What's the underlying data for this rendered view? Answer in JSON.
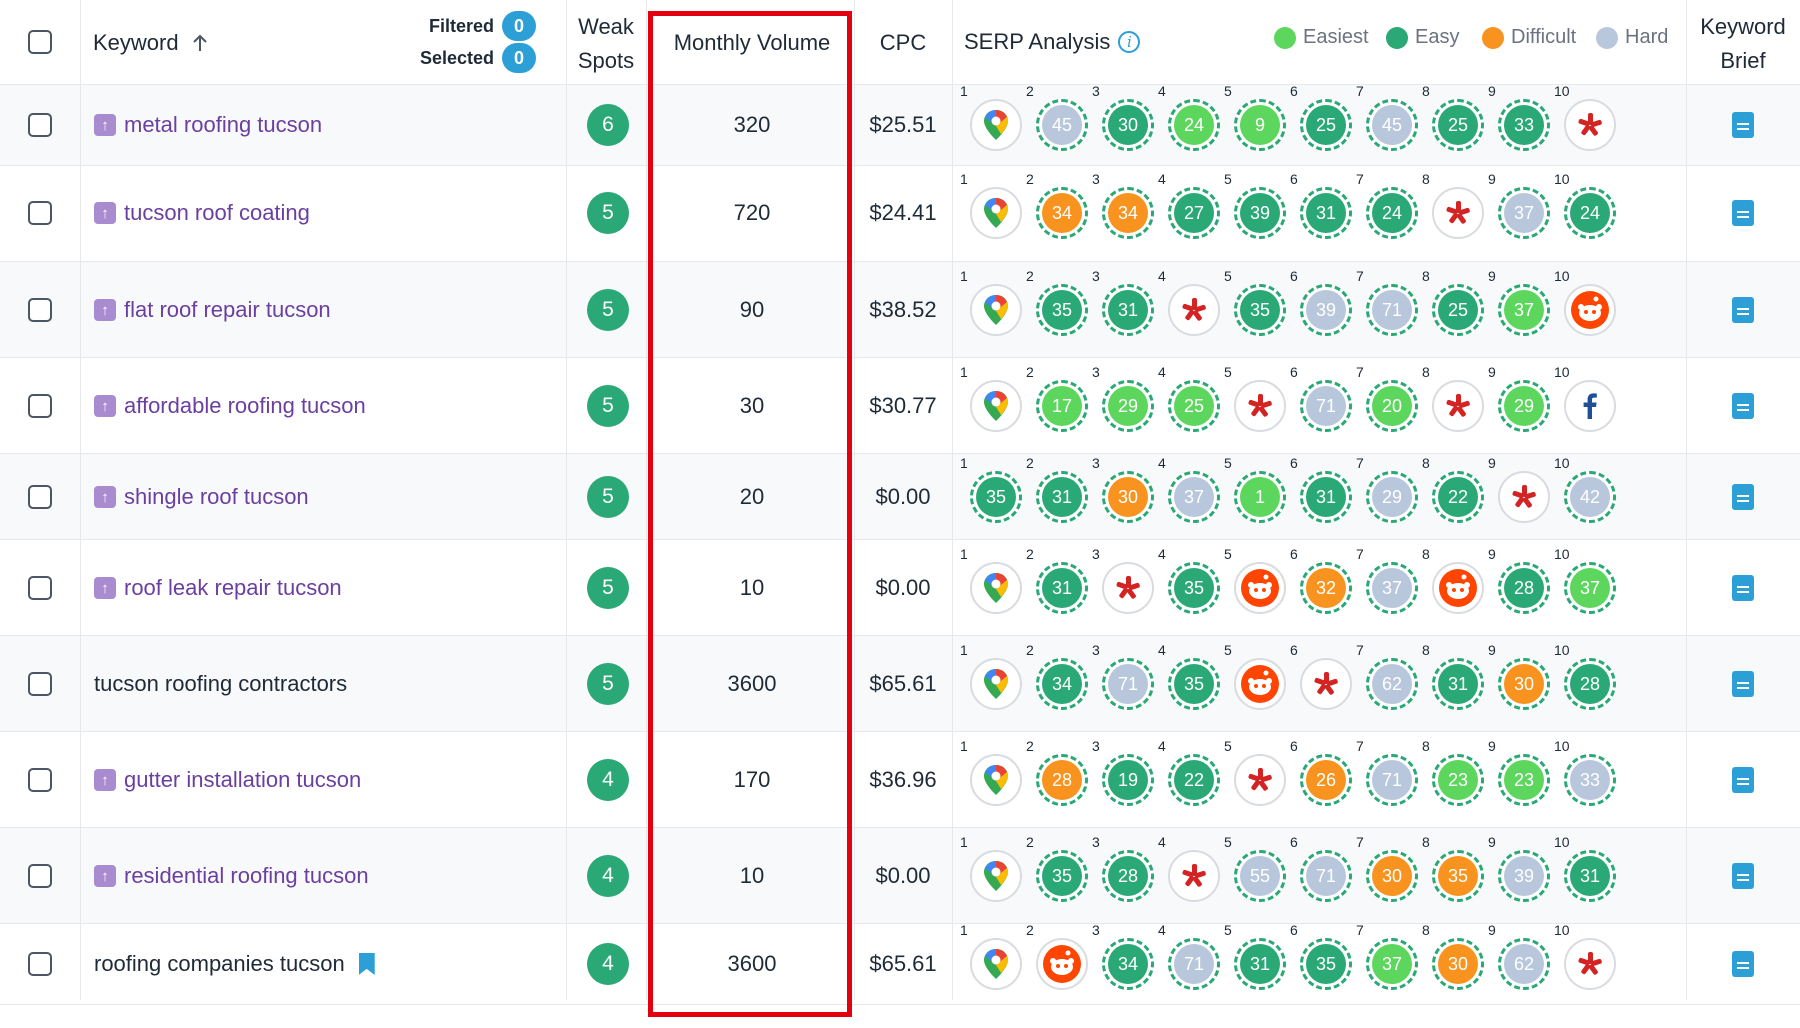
{
  "header": {
    "keyword_label": "Keyword",
    "sort_icon": "arrow-up-icon",
    "filtered_label": "Filtered",
    "filtered_count": "0",
    "selected_label": "Selected",
    "selected_count": "0",
    "weak_spots_line1": "Weak",
    "weak_spots_line2": "Spots",
    "monthly_volume": "Monthly Volume",
    "cpc": "CPC",
    "serp_analysis": "SERP Analysis",
    "keyword_brief_line1": "Keyword",
    "keyword_brief_line2": "Brief",
    "info_glyph": "i"
  },
  "legend": [
    {
      "label": "Easiest",
      "color": "#5cd65c"
    },
    {
      "label": "Easy",
      "color": "#2aa876"
    },
    {
      "label": "Difficult",
      "color": "#f7931e"
    },
    {
      "label": "Hard",
      "color": "#b8c7dc"
    }
  ],
  "colors": {
    "easiest": "#5cd65c",
    "easy": "#2aa876",
    "difficult": "#f7931e",
    "hard": "#b8c7dc",
    "highlight": "#e3000f",
    "keyword_link": "#6b3fa0"
  },
  "position_labels": [
    "1",
    "2",
    "3",
    "4",
    "5",
    "6",
    "7",
    "8",
    "9",
    "10"
  ],
  "rows": [
    {
      "keyword": "metal roofing tucson",
      "linked": true,
      "bookmark": false,
      "weak_spots": "6",
      "volume": "320",
      "cpc": "$25.51",
      "serp": [
        {
          "t": "maps"
        },
        {
          "t": "hard",
          "v": "45"
        },
        {
          "t": "easy",
          "v": "30"
        },
        {
          "t": "easiest",
          "v": "24"
        },
        {
          "t": "easiest",
          "v": "9"
        },
        {
          "t": "easy",
          "v": "25"
        },
        {
          "t": "hard",
          "v": "45"
        },
        {
          "t": "easy",
          "v": "25"
        },
        {
          "t": "easy",
          "v": "33"
        },
        {
          "t": "yelp"
        }
      ]
    },
    {
      "keyword": "tucson roof coating",
      "linked": true,
      "bookmark": false,
      "weak_spots": "5",
      "volume": "720",
      "cpc": "$24.41",
      "serp": [
        {
          "t": "maps"
        },
        {
          "t": "difficult",
          "v": "34"
        },
        {
          "t": "difficult",
          "v": "34"
        },
        {
          "t": "easy",
          "v": "27"
        },
        {
          "t": "easy",
          "v": "39"
        },
        {
          "t": "easy",
          "v": "31"
        },
        {
          "t": "easy",
          "v": "24"
        },
        {
          "t": "yelp"
        },
        {
          "t": "hard",
          "v": "37"
        },
        {
          "t": "easy",
          "v": "24"
        }
      ]
    },
    {
      "keyword": "flat roof repair tucson",
      "linked": true,
      "bookmark": false,
      "weak_spots": "5",
      "volume": "90",
      "cpc": "$38.52",
      "serp": [
        {
          "t": "maps"
        },
        {
          "t": "easy",
          "v": "35"
        },
        {
          "t": "easy",
          "v": "31"
        },
        {
          "t": "yelp"
        },
        {
          "t": "easy",
          "v": "35"
        },
        {
          "t": "hard",
          "v": "39"
        },
        {
          "t": "hard",
          "v": "71"
        },
        {
          "t": "easy",
          "v": "25"
        },
        {
          "t": "easiest",
          "v": "37"
        },
        {
          "t": "reddit"
        }
      ]
    },
    {
      "keyword": "affordable roofing tucson",
      "linked": true,
      "bookmark": false,
      "weak_spots": "5",
      "volume": "30",
      "cpc": "$30.77",
      "serp": [
        {
          "t": "maps"
        },
        {
          "t": "easiest",
          "v": "17"
        },
        {
          "t": "easiest",
          "v": "29"
        },
        {
          "t": "easiest",
          "v": "25"
        },
        {
          "t": "yelp"
        },
        {
          "t": "hard",
          "v": "71"
        },
        {
          "t": "easiest",
          "v": "20"
        },
        {
          "t": "yelp"
        },
        {
          "t": "easiest",
          "v": "29"
        },
        {
          "t": "facebook"
        }
      ]
    },
    {
      "keyword": "shingle roof tucson",
      "linked": true,
      "bookmark": false,
      "weak_spots": "5",
      "volume": "20",
      "cpc": "$0.00",
      "serp": [
        {
          "t": "easy",
          "v": "35"
        },
        {
          "t": "easy",
          "v": "31"
        },
        {
          "t": "difficult",
          "v": "30"
        },
        {
          "t": "hard",
          "v": "37"
        },
        {
          "t": "easiest",
          "v": "1"
        },
        {
          "t": "easy",
          "v": "31"
        },
        {
          "t": "hard",
          "v": "29"
        },
        {
          "t": "easy",
          "v": "22"
        },
        {
          "t": "yelp"
        },
        {
          "t": "hard",
          "v": "42"
        }
      ]
    },
    {
      "keyword": "roof leak repair tucson",
      "linked": true,
      "bookmark": false,
      "weak_spots": "5",
      "volume": "10",
      "cpc": "$0.00",
      "serp": [
        {
          "t": "maps"
        },
        {
          "t": "easy",
          "v": "31"
        },
        {
          "t": "yelp"
        },
        {
          "t": "easy",
          "v": "35"
        },
        {
          "t": "reddit"
        },
        {
          "t": "difficult",
          "v": "32"
        },
        {
          "t": "hard",
          "v": "37"
        },
        {
          "t": "reddit"
        },
        {
          "t": "easy",
          "v": "28"
        },
        {
          "t": "easiest",
          "v": "37"
        }
      ]
    },
    {
      "keyword": "tucson roofing contractors",
      "linked": false,
      "bookmark": false,
      "weak_spots": "5",
      "volume": "3600",
      "cpc": "$65.61",
      "serp": [
        {
          "t": "maps"
        },
        {
          "t": "easy",
          "v": "34"
        },
        {
          "t": "hard",
          "v": "71"
        },
        {
          "t": "easy",
          "v": "35"
        },
        {
          "t": "reddit"
        },
        {
          "t": "yelp"
        },
        {
          "t": "hard",
          "v": "62"
        },
        {
          "t": "easy",
          "v": "31"
        },
        {
          "t": "difficult",
          "v": "30"
        },
        {
          "t": "easy",
          "v": "28"
        }
      ]
    },
    {
      "keyword": "gutter installation tucson",
      "linked": true,
      "bookmark": false,
      "weak_spots": "4",
      "volume": "170",
      "cpc": "$36.96",
      "serp": [
        {
          "t": "maps"
        },
        {
          "t": "difficult",
          "v": "28"
        },
        {
          "t": "easy",
          "v": "19"
        },
        {
          "t": "easy",
          "v": "22"
        },
        {
          "t": "yelp"
        },
        {
          "t": "difficult",
          "v": "26"
        },
        {
          "t": "hard",
          "v": "71"
        },
        {
          "t": "easiest",
          "v": "23"
        },
        {
          "t": "easiest",
          "v": "23"
        },
        {
          "t": "hard",
          "v": "33"
        }
      ]
    },
    {
      "keyword": "residential roofing tucson",
      "linked": true,
      "bookmark": false,
      "weak_spots": "4",
      "volume": "10",
      "cpc": "$0.00",
      "serp": [
        {
          "t": "maps"
        },
        {
          "t": "easy",
          "v": "35"
        },
        {
          "t": "easy",
          "v": "28"
        },
        {
          "t": "yelp"
        },
        {
          "t": "hard",
          "v": "55"
        },
        {
          "t": "hard",
          "v": "71"
        },
        {
          "t": "difficult",
          "v": "30"
        },
        {
          "t": "difficult",
          "v": "35"
        },
        {
          "t": "hard",
          "v": "39"
        },
        {
          "t": "easy",
          "v": "31"
        }
      ]
    },
    {
      "keyword": "roofing companies tucson",
      "linked": false,
      "bookmark": true,
      "weak_spots": "4",
      "volume": "3600",
      "cpc": "$65.61",
      "serp": [
        {
          "t": "maps"
        },
        {
          "t": "reddit"
        },
        {
          "t": "easy",
          "v": "34"
        },
        {
          "t": "hard",
          "v": "71"
        },
        {
          "t": "easy",
          "v": "31"
        },
        {
          "t": "easy",
          "v": "35"
        },
        {
          "t": "easiest",
          "v": "37"
        },
        {
          "t": "difficult",
          "v": "30"
        },
        {
          "t": "hard",
          "v": "62"
        },
        {
          "t": "yelp"
        }
      ]
    }
  ]
}
